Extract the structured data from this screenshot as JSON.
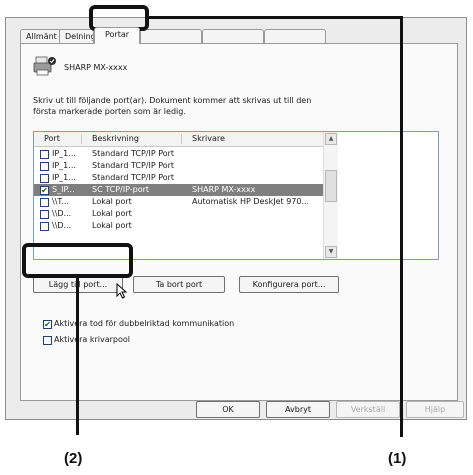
{
  "tabs": [
    "Allmänt",
    "Delning",
    "Portar",
    "",
    "",
    ""
  ],
  "printer": {
    "name": "SHARP MX-xxxx",
    "icon": "printer-icon"
  },
  "description": [
    "Skriv ut till följande port(ar). Dokument kommer att skrivas ut till den",
    "första markerade porten som är ledig."
  ],
  "port_list": {
    "columns": [
      "Port",
      "Beskrivning",
      "Skrivare"
    ],
    "rows": [
      {
        "checked": false,
        "port": "IP_1...",
        "description": "Standard TCP/IP Port",
        "printer": ""
      },
      {
        "checked": false,
        "port": "IP_1...",
        "description": "Standard TCP/IP Port",
        "printer": ""
      },
      {
        "checked": false,
        "port": "IP_1...",
        "description": "Standard TCP/IP Port",
        "printer": ""
      },
      {
        "checked": true,
        "port": "S_IP...",
        "description": "SC TCP/IP-port",
        "printer": "SHARP MX-xxxx",
        "selected": true
      },
      {
        "checked": false,
        "port": "\\\\T...",
        "description": "Lokal port",
        "printer": "Automatisk HP DeskJet 970..."
      },
      {
        "checked": false,
        "port": "\\\\D...",
        "description": "Lokal port",
        "printer": ""
      },
      {
        "checked": false,
        "port": "\\\\D...",
        "description": "Lokal port",
        "printer": ""
      }
    ]
  },
  "buttons": {
    "add_port": "Lägg till port...",
    "delete_port": "Ta bort port",
    "configure_port": "Konfigurera port..."
  },
  "checkboxes": [
    {
      "label": "Aktivera stöd för dubbelriktad kommunikation",
      "label_visible": "Aktivera     tod för dubbelriktad kommunikation",
      "checked": true
    },
    {
      "label": "Aktivera skrivarpool",
      "label_visible": "Aktivera     krivarpool",
      "checked": false
    }
  ],
  "footer": {
    "ok": "OK",
    "cancel": "Avbryt",
    "apply": "Verkställ",
    "help": "Hjälp"
  },
  "callouts": {
    "one": "(1)",
    "two": "(2)"
  }
}
